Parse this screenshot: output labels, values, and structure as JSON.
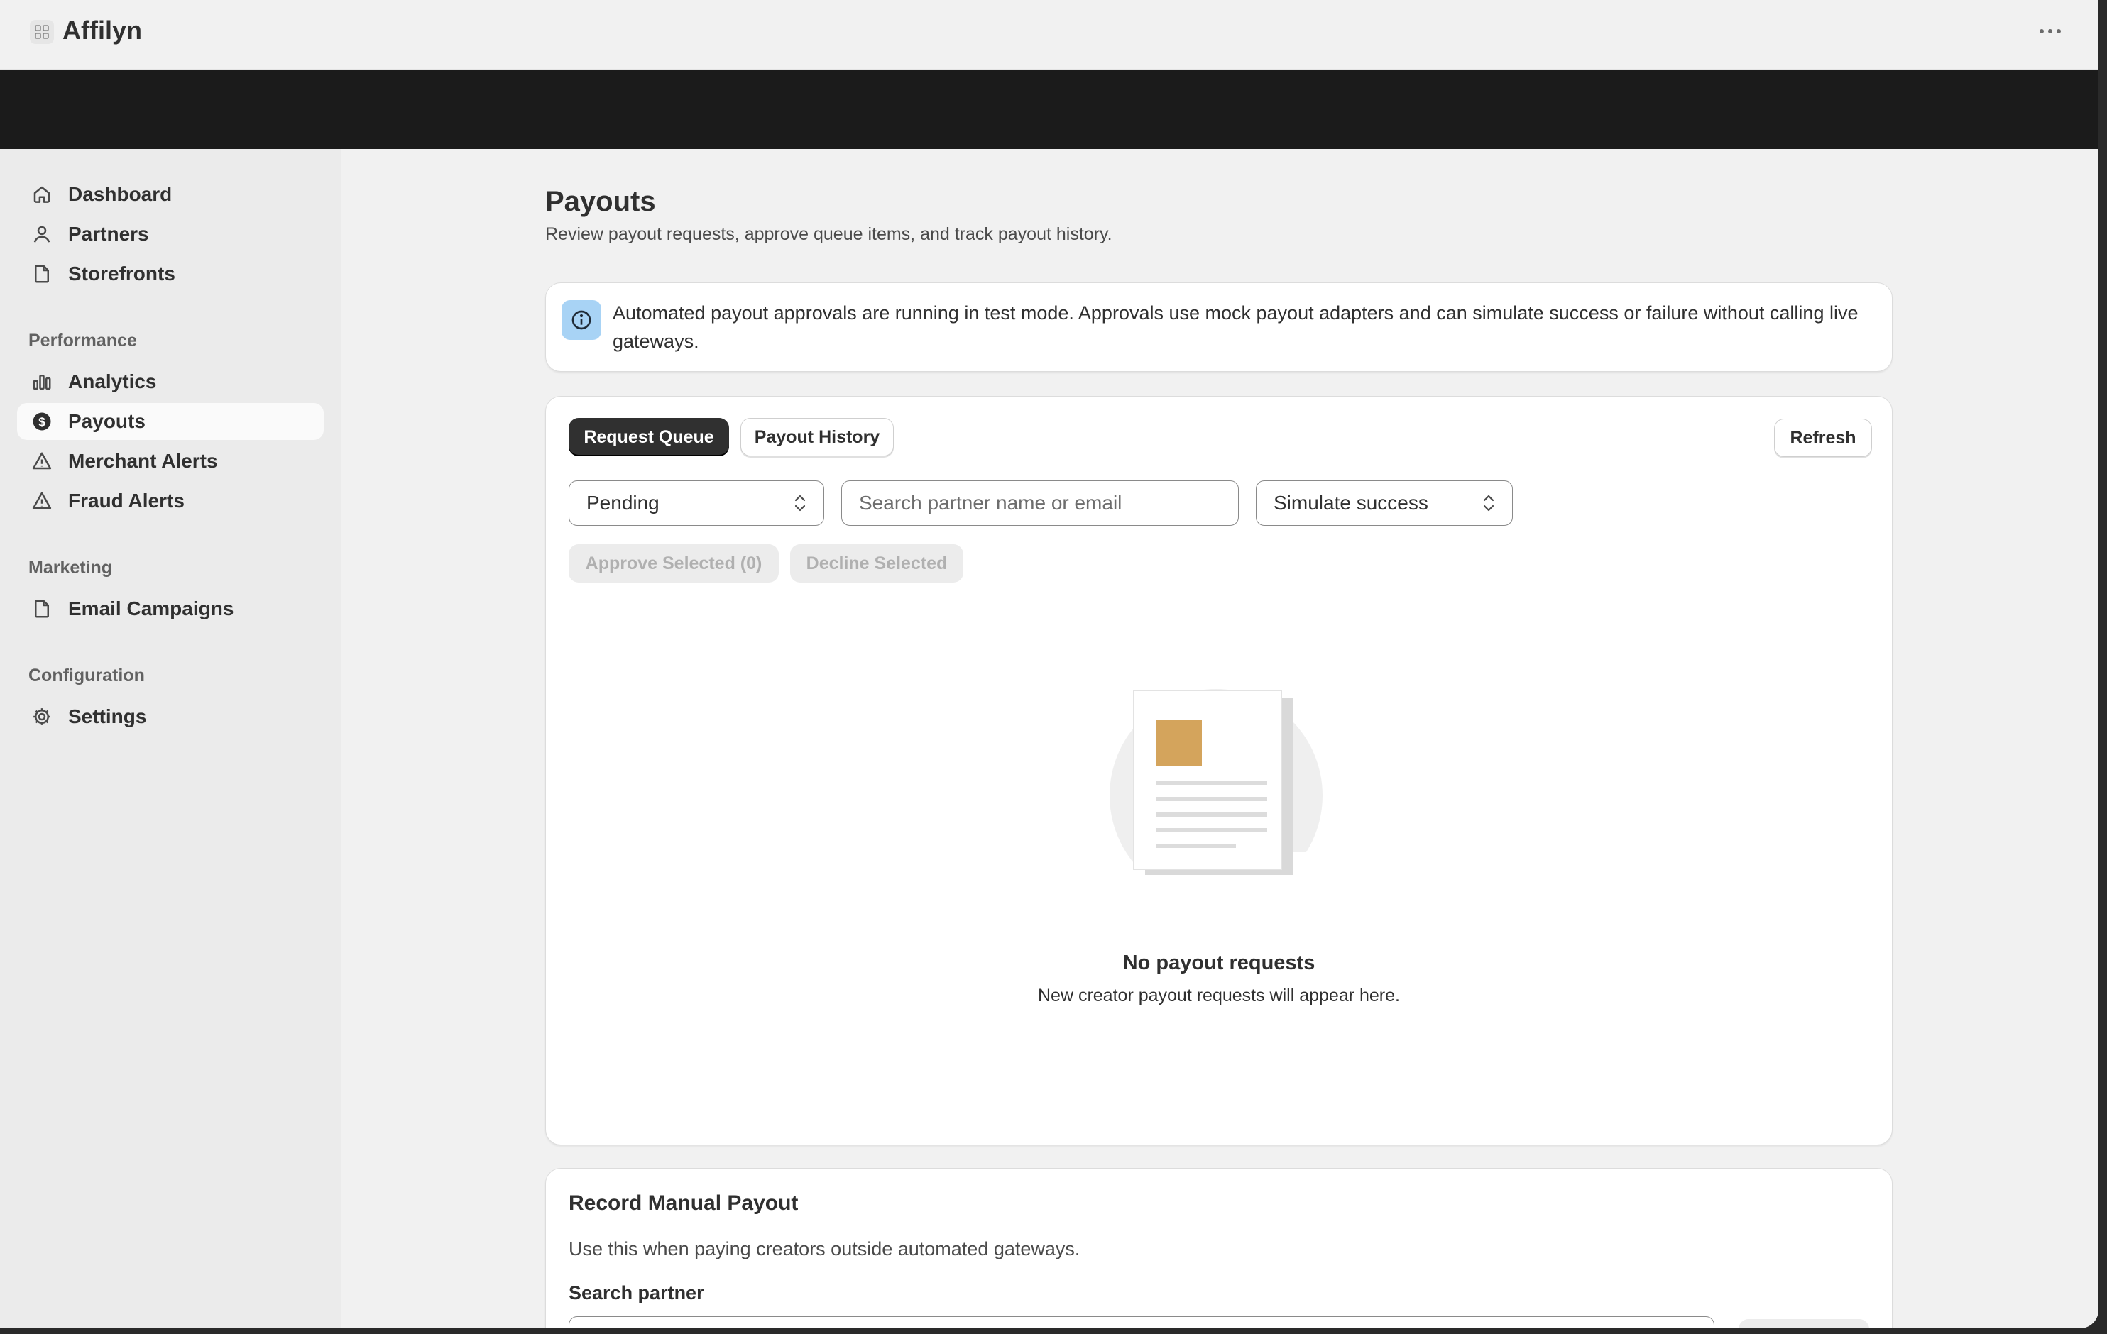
{
  "app": {
    "title": "Affilyn"
  },
  "sidebar": {
    "items": [
      {
        "label": "Dashboard",
        "icon": "home-icon"
      },
      {
        "label": "Partners",
        "icon": "person-icon"
      },
      {
        "label": "Storefronts",
        "icon": "page-icon"
      }
    ],
    "sections": [
      {
        "heading": "Performance",
        "items": [
          {
            "label": "Analytics",
            "icon": "bar-chart-icon"
          },
          {
            "label": "Payouts",
            "icon": "dollar-circle-icon",
            "active": true
          },
          {
            "label": "Merchant Alerts",
            "icon": "warning-icon"
          },
          {
            "label": "Fraud Alerts",
            "icon": "warning-icon"
          }
        ]
      },
      {
        "heading": "Marketing",
        "items": [
          {
            "label": "Email Campaigns",
            "icon": "page-icon"
          }
        ]
      },
      {
        "heading": "Configuration",
        "items": [
          {
            "label": "Settings",
            "icon": "gear-icon"
          }
        ]
      }
    ]
  },
  "page": {
    "title": "Payouts",
    "subtitle": "Review payout requests, approve queue items, and track payout history."
  },
  "banner": {
    "text": "Automated payout approvals are running in test mode. Approvals use mock payout adapters and can simulate success or failure without calling live gateways."
  },
  "queue": {
    "tabs": [
      {
        "label": "Request Queue",
        "active": true
      },
      {
        "label": "Payout History",
        "active": false
      }
    ],
    "refresh_label": "Refresh",
    "status_filter": {
      "value": "Pending"
    },
    "search": {
      "placeholder": "Search partner name or email",
      "value": ""
    },
    "simulate": {
      "value": "Simulate success"
    },
    "approve_label": "Approve Selected (0)",
    "decline_label": "Decline Selected",
    "empty_title": "No payout requests",
    "empty_subtitle": "New creator payout requests will appear here."
  },
  "manual": {
    "title": "Record Manual Payout",
    "subtitle": "Use this when paying creators outside automated gateways.",
    "search_label": "Search partner"
  },
  "colors": {
    "accent_dark": "#303030",
    "info_blue": "#a8d3f5",
    "illustration_gold": "#d4a45c"
  }
}
